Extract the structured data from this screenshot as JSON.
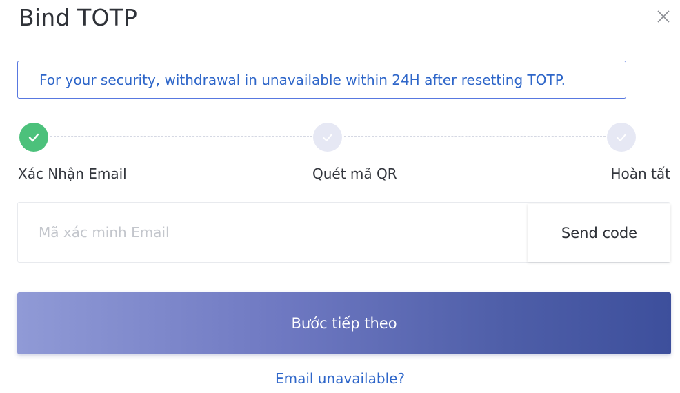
{
  "dialog": {
    "title": "Bind TOTP",
    "close_icon": "close-icon"
  },
  "notice": {
    "text": "For your security, withdrawal in unavailable within 24H after resetting TOTP."
  },
  "steps": [
    {
      "label": "Xác Nhận Email",
      "status": "done",
      "icon": "check-icon"
    },
    {
      "label": "Quét mã QR",
      "status": "pending",
      "icon": "check-icon"
    },
    {
      "label": "Hoàn tất",
      "status": "pending",
      "icon": "check-icon"
    }
  ],
  "form": {
    "code_input": {
      "value": "",
      "placeholder": "Mã xác minh Email"
    },
    "send_code_label": "Send code",
    "next_label": "Bước tiếp theo",
    "email_unavailable_link": "Email unavailable?"
  },
  "colors": {
    "accent_blue": "#2e66c9",
    "success_green": "#4cc17b",
    "pending_step": "#e6e8f4",
    "button_gradient_start": "#909ad6",
    "button_gradient_end": "#3d4f9c"
  }
}
